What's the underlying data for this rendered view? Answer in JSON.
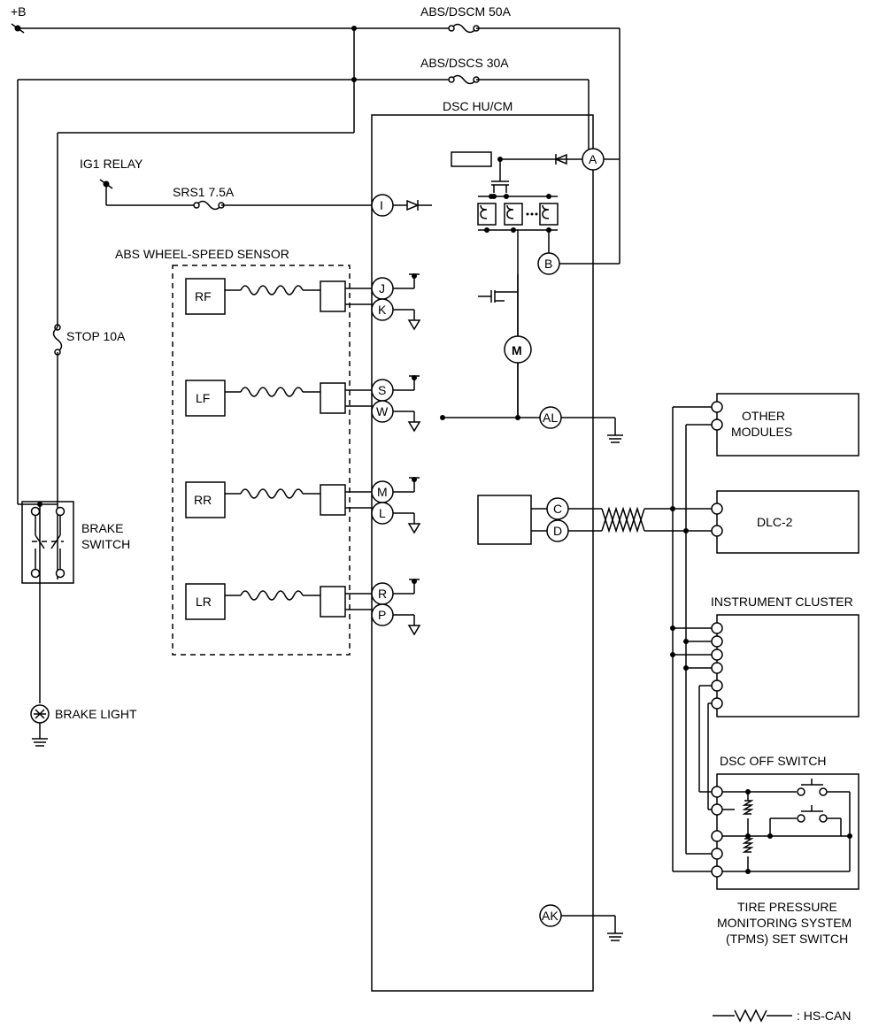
{
  "labels": {
    "plusB": "+B",
    "fuse50": "ABS/DSCM 50A",
    "fuse30": "ABS/DSCS 30A",
    "dscHuCm": "DSC HU/CM",
    "ig1Relay": "IG1 RELAY",
    "srs1": "SRS1 7.5A",
    "absWss": "ABS WHEEL-SPEED SENSOR",
    "rf": "RF",
    "lf": "LF",
    "rr": "RR",
    "lr": "LR",
    "stop10a": "STOP 10A",
    "brakeSwitch": "BRAKE\nSWITCH",
    "brakeLight": "BRAKE LIGHT",
    "otherModules": "OTHER\nMODULES",
    "dlc2": "DLC-2",
    "instCluster": "INSTRUMENT CLUSTER",
    "dscOffSw": "DSC OFF SWITCH",
    "tpms1": "TIRE PRESSURE",
    "tpms2": "MONITORING SYSTEM",
    "tpms3": "(TPMS) SET SWITCH",
    "hsCan": ": HS-CAN",
    "motor": "M"
  },
  "pins": {
    "A": "A",
    "B": "B",
    "I": "I",
    "J": "J",
    "K": "K",
    "S": "S",
    "W": "W",
    "M": "M",
    "L": "L",
    "R": "R",
    "P": "P",
    "AL": "AL",
    "C": "C",
    "D": "D",
    "AK": "AK"
  }
}
